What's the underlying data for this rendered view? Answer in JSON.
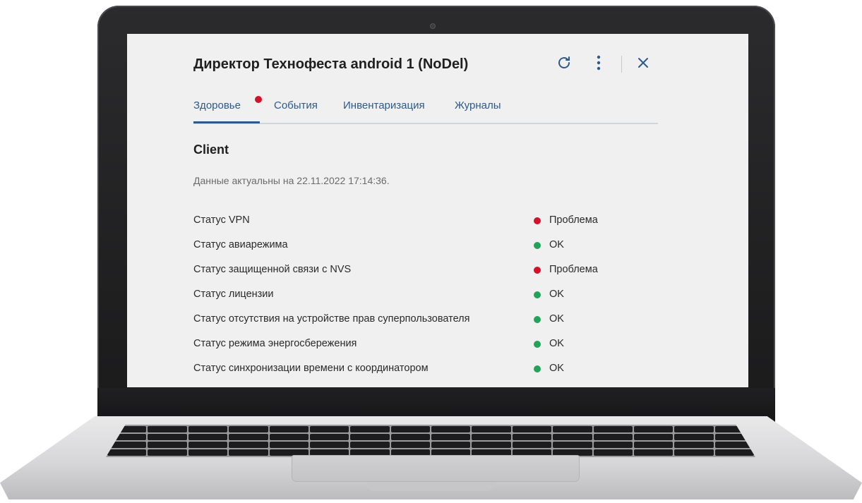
{
  "window": {
    "title": "Директор Технофеста android 1 (NoDel)"
  },
  "toolbar": {
    "refresh_icon": "refresh-icon",
    "more_icon": "more-vertical-icon",
    "close_icon": "close-icon"
  },
  "tabs": [
    {
      "label": "Здоровье",
      "active": true,
      "badge": true
    },
    {
      "label": "События"
    },
    {
      "label": "Инвентаризация"
    },
    {
      "label": "Журналы"
    }
  ],
  "section": {
    "title": "Client",
    "updated_text": "Данные актуальны на 22.11.2022 17:14:36."
  },
  "statuses": [
    {
      "name": "Статус VPN",
      "value": "Проблема",
      "state": "problem"
    },
    {
      "name": "Статус авиарежима",
      "value": "OK",
      "state": "ok"
    },
    {
      "name": "Статус защищенной связи с NVS",
      "value": "Проблема",
      "state": "problem"
    },
    {
      "name": "Статус лицензии",
      "value": "OK",
      "state": "ok"
    },
    {
      "name": "Статус отсутствия на устройстве прав суперпользователя",
      "value": "OK",
      "state": "ok"
    },
    {
      "name": "Статус режима энергосбережения",
      "value": "OK",
      "state": "ok"
    },
    {
      "name": "Статус синхронизации времени с координатором",
      "value": "OK",
      "state": "ok"
    }
  ],
  "colors": {
    "accent": "#2d5a8a",
    "problem": "#d3122a",
    "ok": "#23a35a",
    "badge": "#d3122a"
  }
}
